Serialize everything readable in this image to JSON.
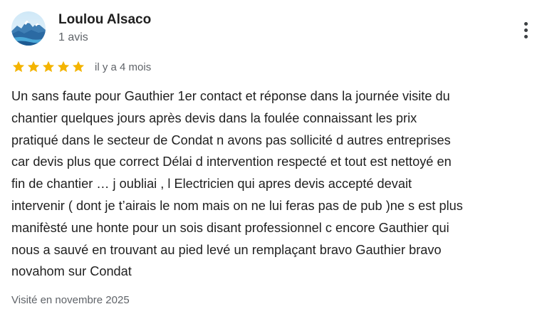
{
  "author": {
    "name": "Loulou Alsaco",
    "review_count": "1 avis",
    "avatar_icon": "mountain-landscape-avatar"
  },
  "menu": {
    "icon": "more-vert-icon"
  },
  "rating": {
    "stars": 5,
    "max_stars": 5,
    "star_color": "#f4b400",
    "date": "il y a 4 mois"
  },
  "review": {
    "text_lines": [
      "Un sans faute pour Gauthier 1er contact et réponse dans la journée visite du",
      "chantier quelques jours après devis dans la foulée connaissant les prix",
      "pratiqué dans le secteur de Condat n avons pas sollicité d autres entreprises",
      "car devis plus que correct Délai d intervention respecté et tout est nettoyé en",
      "fin de chantier … j oubliai , l Electricien qui apres devis accepté devait",
      "intervenir ( dont je t’airais le nom mais on ne lui feras pas de pub )ne s est plus",
      "manifèsté une honte pour un sois disant professionnel c encore Gauthier qui",
      "nous a sauvé en trouvant au pied levé un remplaçant bravo Gauthier bravo",
      "novahom sur Condat"
    ],
    "visited": "Visité en novembre 2025"
  }
}
